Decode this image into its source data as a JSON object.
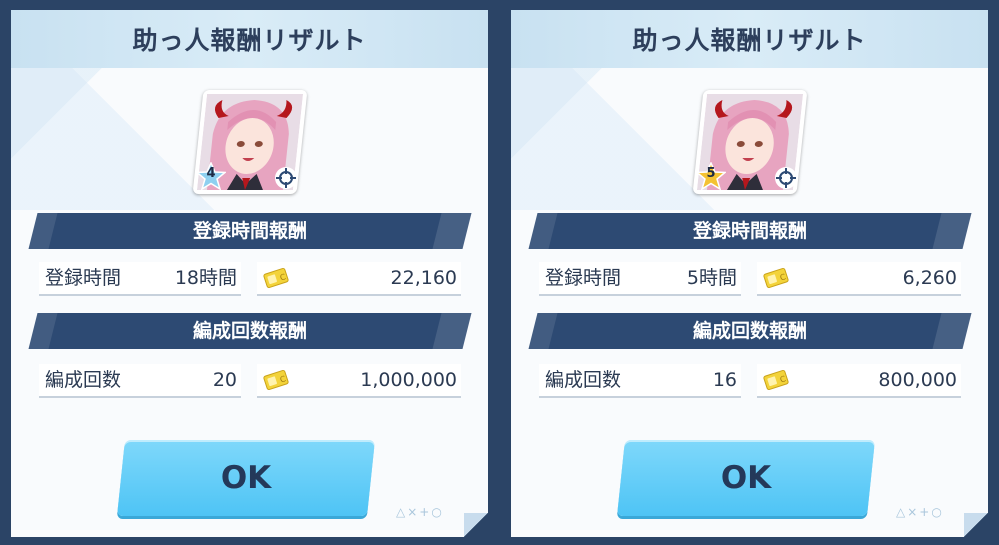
{
  "colors": {
    "background": "#2b4466",
    "panel": "#f9fbfd",
    "title_bar": "#c8e1f1",
    "section_header": "#2d4a73",
    "ok_button": "#4ec4f5",
    "text_dark": "#2b3a52"
  },
  "panels": [
    {
      "title": "助っ人報酬リザルト",
      "rank": "4",
      "rank_color": "#8ed0f0",
      "section1_title": "登録時間報酬",
      "reg_time_label": "登録時間",
      "reg_time_value": "18時間",
      "reg_reward": "22,160",
      "section2_title": "編成回数報酬",
      "party_count_label": "編成回数",
      "party_count_value": "20",
      "party_reward": "1,000,000",
      "ok_label": "OK",
      "hints": "△×+○"
    },
    {
      "title": "助っ人報酬リザルト",
      "rank": "5",
      "rank_color": "#f4c232",
      "section1_title": "登録時間報酬",
      "reg_time_label": "登録時間",
      "reg_time_value": "5時間",
      "reg_reward": "6,260",
      "section2_title": "編成回数報酬",
      "party_count_label": "編成回数",
      "party_count_value": "16",
      "party_reward": "800,000",
      "ok_label": "OK",
      "hints": "△×+○"
    }
  ],
  "icons": {
    "coin": "coin-ticket-icon",
    "target": "target-crosshair-icon",
    "star": "rank-star-icon"
  }
}
